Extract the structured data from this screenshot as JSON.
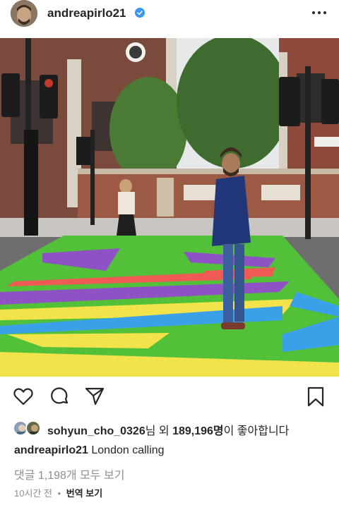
{
  "header": {
    "username": "andreapirlo21",
    "icons": {
      "verified": "verified-badge-icon",
      "more": "more-options-icon"
    },
    "colors": {
      "verified": "#3897f0"
    }
  },
  "post": {
    "liked_by_prefix_user": "sohyun_cho_0326",
    "liked_by_middle": "님 외 ",
    "likes_count": "189,196명",
    "liked_by_suffix": "이 좋아합니다",
    "caption_user": "andreapirlo21",
    "caption_text": " London calling",
    "comments_link": "댓글 1,198개 모두 보기",
    "time_ago": "10시간 전",
    "dot": "•",
    "translate_label": "번역 보기"
  },
  "actions": {
    "icons": [
      "heart-icon",
      "comment-icon",
      "share-icon",
      "bookmark-icon"
    ]
  }
}
